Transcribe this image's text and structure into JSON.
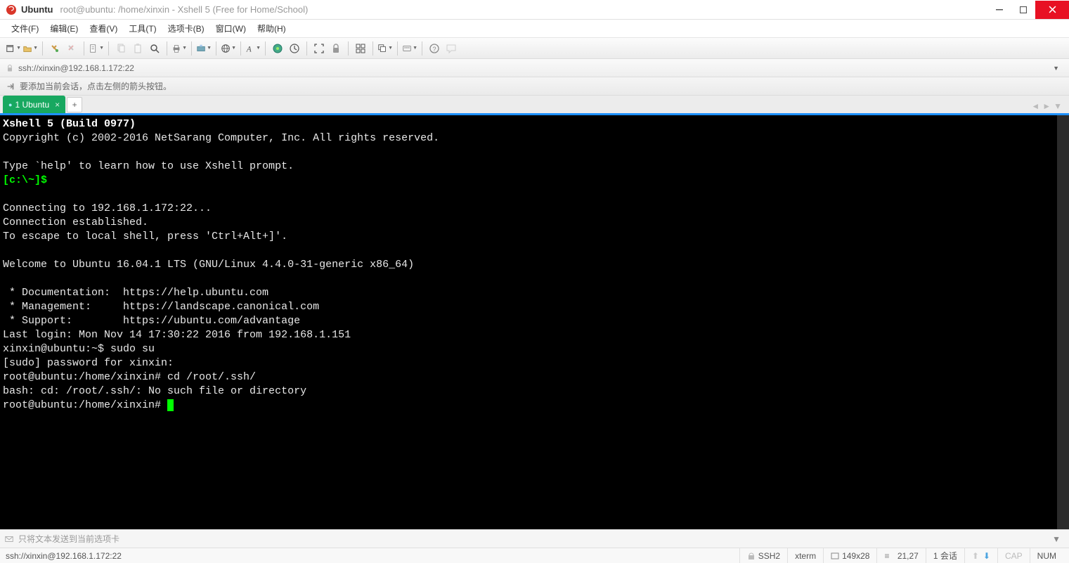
{
  "titlebar": {
    "session_name": "Ubuntu",
    "title_rest": "root@ubuntu: /home/xinxin - Xshell 5 (Free for Home/School)"
  },
  "menubar": {
    "items": [
      "文件(F)",
      "编辑(E)",
      "查看(V)",
      "工具(T)",
      "选项卡(B)",
      "窗口(W)",
      "帮助(H)"
    ]
  },
  "addressbar": {
    "url": "ssh://xinxin@192.168.1.172:22"
  },
  "tipbar": {
    "text": "要添加当前会话，点击左侧的箭头按钮。"
  },
  "tabs": {
    "active": {
      "index": "1",
      "label": "Ubuntu"
    }
  },
  "terminal": {
    "lines": [
      {
        "cls": "t-bold",
        "text": "Xshell 5 (Build 0977)"
      },
      {
        "cls": "",
        "text": "Copyright (c) 2002-2016 NetSarang Computer, Inc. All rights reserved."
      },
      {
        "cls": "",
        "text": ""
      },
      {
        "cls": "",
        "text": "Type `help' to learn how to use Xshell prompt."
      },
      {
        "cls": "t-green",
        "text": "[c:\\~]$ "
      },
      {
        "cls": "",
        "text": ""
      },
      {
        "cls": "",
        "text": "Connecting to 192.168.1.172:22..."
      },
      {
        "cls": "",
        "text": "Connection established."
      },
      {
        "cls": "",
        "text": "To escape to local shell, press 'Ctrl+Alt+]'."
      },
      {
        "cls": "",
        "text": ""
      },
      {
        "cls": "",
        "text": "Welcome to Ubuntu 16.04.1 LTS (GNU/Linux 4.4.0-31-generic x86_64)"
      },
      {
        "cls": "",
        "text": ""
      },
      {
        "cls": "",
        "text": " * Documentation:  https://help.ubuntu.com"
      },
      {
        "cls": "",
        "text": " * Management:     https://landscape.canonical.com"
      },
      {
        "cls": "",
        "text": " * Support:        https://ubuntu.com/advantage"
      },
      {
        "cls": "",
        "text": "Last login: Mon Nov 14 17:30:22 2016 from 192.168.1.151"
      },
      {
        "cls": "",
        "text": "xinxin@ubuntu:~$ sudo su"
      },
      {
        "cls": "",
        "text": "[sudo] password for xinxin: "
      },
      {
        "cls": "",
        "text": "root@ubuntu:/home/xinxin# cd /root/.ssh/"
      },
      {
        "cls": "",
        "text": "bash: cd: /root/.ssh/: No such file or directory"
      }
    ],
    "prompt_last": "root@ubuntu:/home/xinxin# "
  },
  "inputbar": {
    "placeholder": "只将文本发送到当前选项卡"
  },
  "statusbar": {
    "conn": "ssh://xinxin@192.168.1.172:22",
    "proto": "SSH2",
    "term": "xterm",
    "size": "149x28",
    "cursor": "21,27",
    "sessions": "1 会话",
    "caps": "CAP",
    "num": "NUM"
  }
}
